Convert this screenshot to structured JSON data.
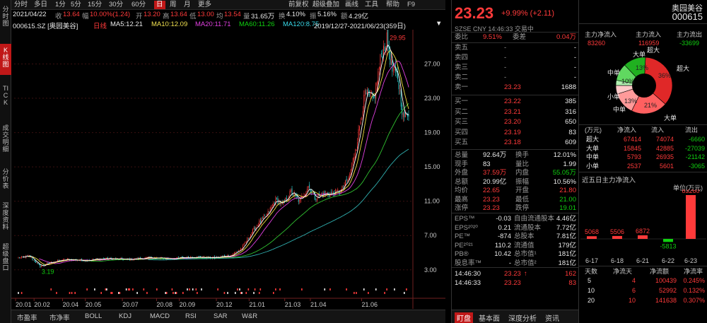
{
  "side_tabs": [
    "分时图",
    "K线图",
    "TICK",
    "成交明细",
    "分价表",
    "深度资料",
    "超级盘口"
  ],
  "toolbar": {
    "items": [
      "分时",
      "多日",
      "1分",
      "5分",
      "15分",
      "30分",
      "60分",
      "日",
      "周",
      "月",
      "更多"
    ],
    "active": "日",
    "right_items": [
      "前复权",
      "超级叠加",
      "画线",
      "工具",
      "帮助",
      "F9"
    ]
  },
  "stats": {
    "date": "2021/04/22",
    "close_label": "收",
    "close": "13.64",
    "change_label": "幅",
    "change": "10.00%(1.24)",
    "open_label": "开",
    "open": "13.20",
    "high_label": "高",
    "high": "13.64",
    "low_label": "低",
    "low": "13.00",
    "avg_label": "均",
    "avg": "13.54",
    "volume_label": "量",
    "volume": "31.65万",
    "turnover_label": "换",
    "turnover": "4.10%",
    "amplitude_label": "振",
    "amplitude": "5.16%",
    "amount_label": "额",
    "amount": "4.29亿"
  },
  "ma_bar": {
    "code": "000615.SZ [奥园美谷]",
    "type": "日线",
    "ma5": "MA5:12.21",
    "ma10": "MA10:12.09",
    "ma20": "MA20:11.71",
    "ma60": "MA60:11.26",
    "ma120": "MA120:8.75",
    "range": "2019/12/27-2021/06/23(359日)"
  },
  "chart_data": {
    "type": "candlestick",
    "y_ticks": [
      "27.00",
      "23.00",
      "19.00",
      "15.00",
      "11.00",
      "7.00",
      "3.00"
    ],
    "x_ticks": [
      "20.01",
      "20.02",
      "20.04",
      "20.05",
      "20.07",
      "20.08",
      "20.09",
      "20.12",
      "21.01",
      "21.03",
      "21.04",
      "21.06"
    ],
    "ylim": [
      1.5,
      30.5
    ],
    "max_label": "29.95",
    "min_label": "3.19",
    "colors": {
      "up": "#ff3a3a",
      "down": "#30d8d8",
      "ma5": "#ffffff",
      "ma10": "#f0e040",
      "ma20": "#e040e0",
      "ma60": "#30c030",
      "ma120": "#30b0b0"
    },
    "anchors": [
      [
        0,
        4.4
      ],
      [
        10,
        4.6
      ],
      [
        20,
        3.4
      ],
      [
        30,
        3.9
      ],
      [
        45,
        4.2
      ],
      [
        60,
        4.1
      ],
      [
        80,
        4.3
      ],
      [
        100,
        4.2
      ],
      [
        120,
        4.4
      ],
      [
        140,
        4.3
      ],
      [
        160,
        4.5
      ],
      [
        180,
        4.4
      ],
      [
        195,
        4.7
      ],
      [
        205,
        5.5
      ],
      [
        212,
        7.0
      ],
      [
        220,
        8.4
      ],
      [
        228,
        9.4
      ],
      [
        236,
        11.2
      ],
      [
        242,
        10.6
      ],
      [
        250,
        12.1
      ],
      [
        258,
        11.0
      ],
      [
        266,
        12.8
      ],
      [
        272,
        11.4
      ],
      [
        280,
        11.8
      ],
      [
        288,
        11.9
      ],
      [
        296,
        12.3
      ],
      [
        303,
        13.6
      ],
      [
        310,
        17.5
      ],
      [
        318,
        23.5
      ],
      [
        326,
        22.8
      ],
      [
        333,
        28.2
      ],
      [
        338,
        29.8
      ],
      [
        343,
        26.2
      ],
      [
        348,
        25.4
      ],
      [
        353,
        20.8
      ],
      [
        358,
        21.3
      ]
    ]
  },
  "indicator_tabs": [
    "市盈率",
    "市净率",
    "BOLL",
    "KDJ",
    "MACD",
    "RSI",
    "SAR",
    "W&R"
  ],
  "quote": {
    "price": "23.23",
    "change": "+9.99% (+2.11)",
    "exchange_line": "SZSE CNY 14:46:33 交易中",
    "weibi_label": "委比",
    "weibi": "9.51%",
    "weicha_label": "委差",
    "weicha": "0.04万",
    "asks": [
      {
        "label": "卖五",
        "price": "-",
        "vol": "-"
      },
      {
        "label": "卖四",
        "price": "-",
        "vol": "-"
      },
      {
        "label": "卖三",
        "price": "-",
        "vol": "-"
      },
      {
        "label": "卖二",
        "price": "-",
        "vol": "-"
      },
      {
        "label": "卖一",
        "price": "23.23",
        "vol": "1688"
      }
    ],
    "bids": [
      {
        "label": "买一",
        "price": "23.22",
        "vol": "385"
      },
      {
        "label": "买二",
        "price": "23.21",
        "vol": "316"
      },
      {
        "label": "买三",
        "price": "23.20",
        "vol": "650"
      },
      {
        "label": "买四",
        "price": "23.19",
        "vol": "83"
      },
      {
        "label": "买五",
        "price": "23.18",
        "vol": "609"
      }
    ],
    "stats": [
      {
        "l1": "总量",
        "v1": "92.64万",
        "l2": "换手",
        "v2": "12.01%",
        "c1": "white",
        "c2": "white"
      },
      {
        "l1": "现手",
        "v1": "83",
        "l2": "量比",
        "v2": "1.99",
        "c1": "white",
        "c2": "white"
      },
      {
        "l1": "外盘",
        "v1": "37.59万",
        "l2": "内盘",
        "v2": "55.05万",
        "c1": "red",
        "c2": "green"
      },
      {
        "l1": "总额",
        "v1": "20.99亿",
        "l2": "振幅",
        "v2": "10.56%",
        "c1": "white",
        "c2": "white"
      },
      {
        "l1": "均价",
        "v1": "22.65",
        "l2": "开盘",
        "v2": "21.80",
        "c1": "red",
        "c2": "red"
      },
      {
        "l1": "最高",
        "v1": "23.23",
        "l2": "最低",
        "v2": "21.00",
        "c1": "red",
        "c2": "green"
      },
      {
        "l1": "涨停",
        "v1": "23.23",
        "l2": "跌停",
        "v2": "19.01",
        "c1": "red",
        "c2": "green"
      }
    ],
    "fundamentals": [
      {
        "l1": "EPS™",
        "v1": "-0.03",
        "l2": "自由流通股本",
        "v2": "4.46亿"
      },
      {
        "l1": "EPS²⁰²⁰",
        "v1": "0.21",
        "l2": "流通股本",
        "v2": "7.72亿"
      },
      {
        "l1": "PE™",
        "v1": "-874",
        "l2": "总股本",
        "v2": "7.81亿"
      },
      {
        "l1": "PE²⁰²¹",
        "v1": "110.2",
        "l2": "流通值",
        "v2": "179亿"
      },
      {
        "l1": "PB®",
        "v1": "10.42",
        "l2": "总市值¹",
        "v2": "181亿"
      },
      {
        "l1": "股息率™",
        "v1": "-",
        "l2": "总市值²",
        "v2": "181亿"
      }
    ],
    "ticks": [
      {
        "time": "14:46:30",
        "price": "23.23",
        "arrow": "↑",
        "vol": "162"
      },
      {
        "time": "14:46:33",
        "price": "23.23",
        "arrow": "",
        "vol": "83"
      }
    ],
    "bottom_tabs": [
      "盯盘",
      "基本面",
      "深度分析",
      "资讯"
    ]
  },
  "flow": {
    "name": "奥园美谷",
    "code": "000615",
    "summary_headers": [
      "主力净流入",
      "主力流入",
      "主力流出"
    ],
    "summary_values": [
      "83260",
      "116959",
      "-33699"
    ],
    "pie_labels": {
      "chaoda": "超大",
      "da": "大单",
      "zhong": "中单",
      "xiao": "小单"
    },
    "pie_outer_labels": {
      "top_chaoda": "超大",
      "top_da": "大单",
      "left_zhong": "中单",
      "left_xiao": "小单",
      "right_chaoda": "超大",
      "bottom_zhong": "中单",
      "bottom_da": "大单"
    },
    "pie_pct": {
      "in_chaoda": "36%",
      "in_da": "21%",
      "in_zhong": "13%",
      "in_xiao": "5%",
      "out_chaoda": "13%",
      "out_da": "10%",
      "out_xiao": "3%"
    },
    "pie_values": {
      "in_chaoda": 36,
      "in_da": 21,
      "in_zhong": 13,
      "in_xiao": 5,
      "out_xiao": 3,
      "out_zhong": 10,
      "out_da": 13
    },
    "table_headers": [
      "(万元)",
      "净流入",
      "流入",
      "流出"
    ],
    "table_rows": [
      {
        "name": "超大",
        "net": "67414",
        "in": "74074",
        "out": "-6660"
      },
      {
        "name": "大单",
        "net": "15845",
        "in": "42885",
        "out": "-27039"
      },
      {
        "name": "中单",
        "net": "5793",
        "in": "26935",
        "out": "-21142"
      },
      {
        "name": "小单",
        "net": "2537",
        "in": "5601",
        "out": "-3065"
      }
    ],
    "five_day_title": "近五日主力净流入",
    "unit_label": "单位(万元)",
    "bars": [
      {
        "date": "6-17",
        "value": 5068,
        "label": "5068"
      },
      {
        "date": "6-18",
        "value": 5506,
        "label": "5506"
      },
      {
        "date": "6-21",
        "value": 6872,
        "label": "6872"
      },
      {
        "date": "6-22",
        "value": -5813,
        "label": "-5813"
      },
      {
        "date": "6-23",
        "value": 83260,
        "label": "83260"
      }
    ],
    "period_headers": [
      "天数",
      "净流天",
      "净流额",
      "净流率"
    ],
    "periods": [
      {
        "days": "5",
        "net_days": "4",
        "amount": "100439",
        "rate": "0.245%"
      },
      {
        "days": "10",
        "net_days": "6",
        "amount": "52992",
        "rate": "0.132%"
      },
      {
        "days": "20",
        "net_days": "10",
        "amount": "141638",
        "rate": "0.307%"
      }
    ]
  }
}
